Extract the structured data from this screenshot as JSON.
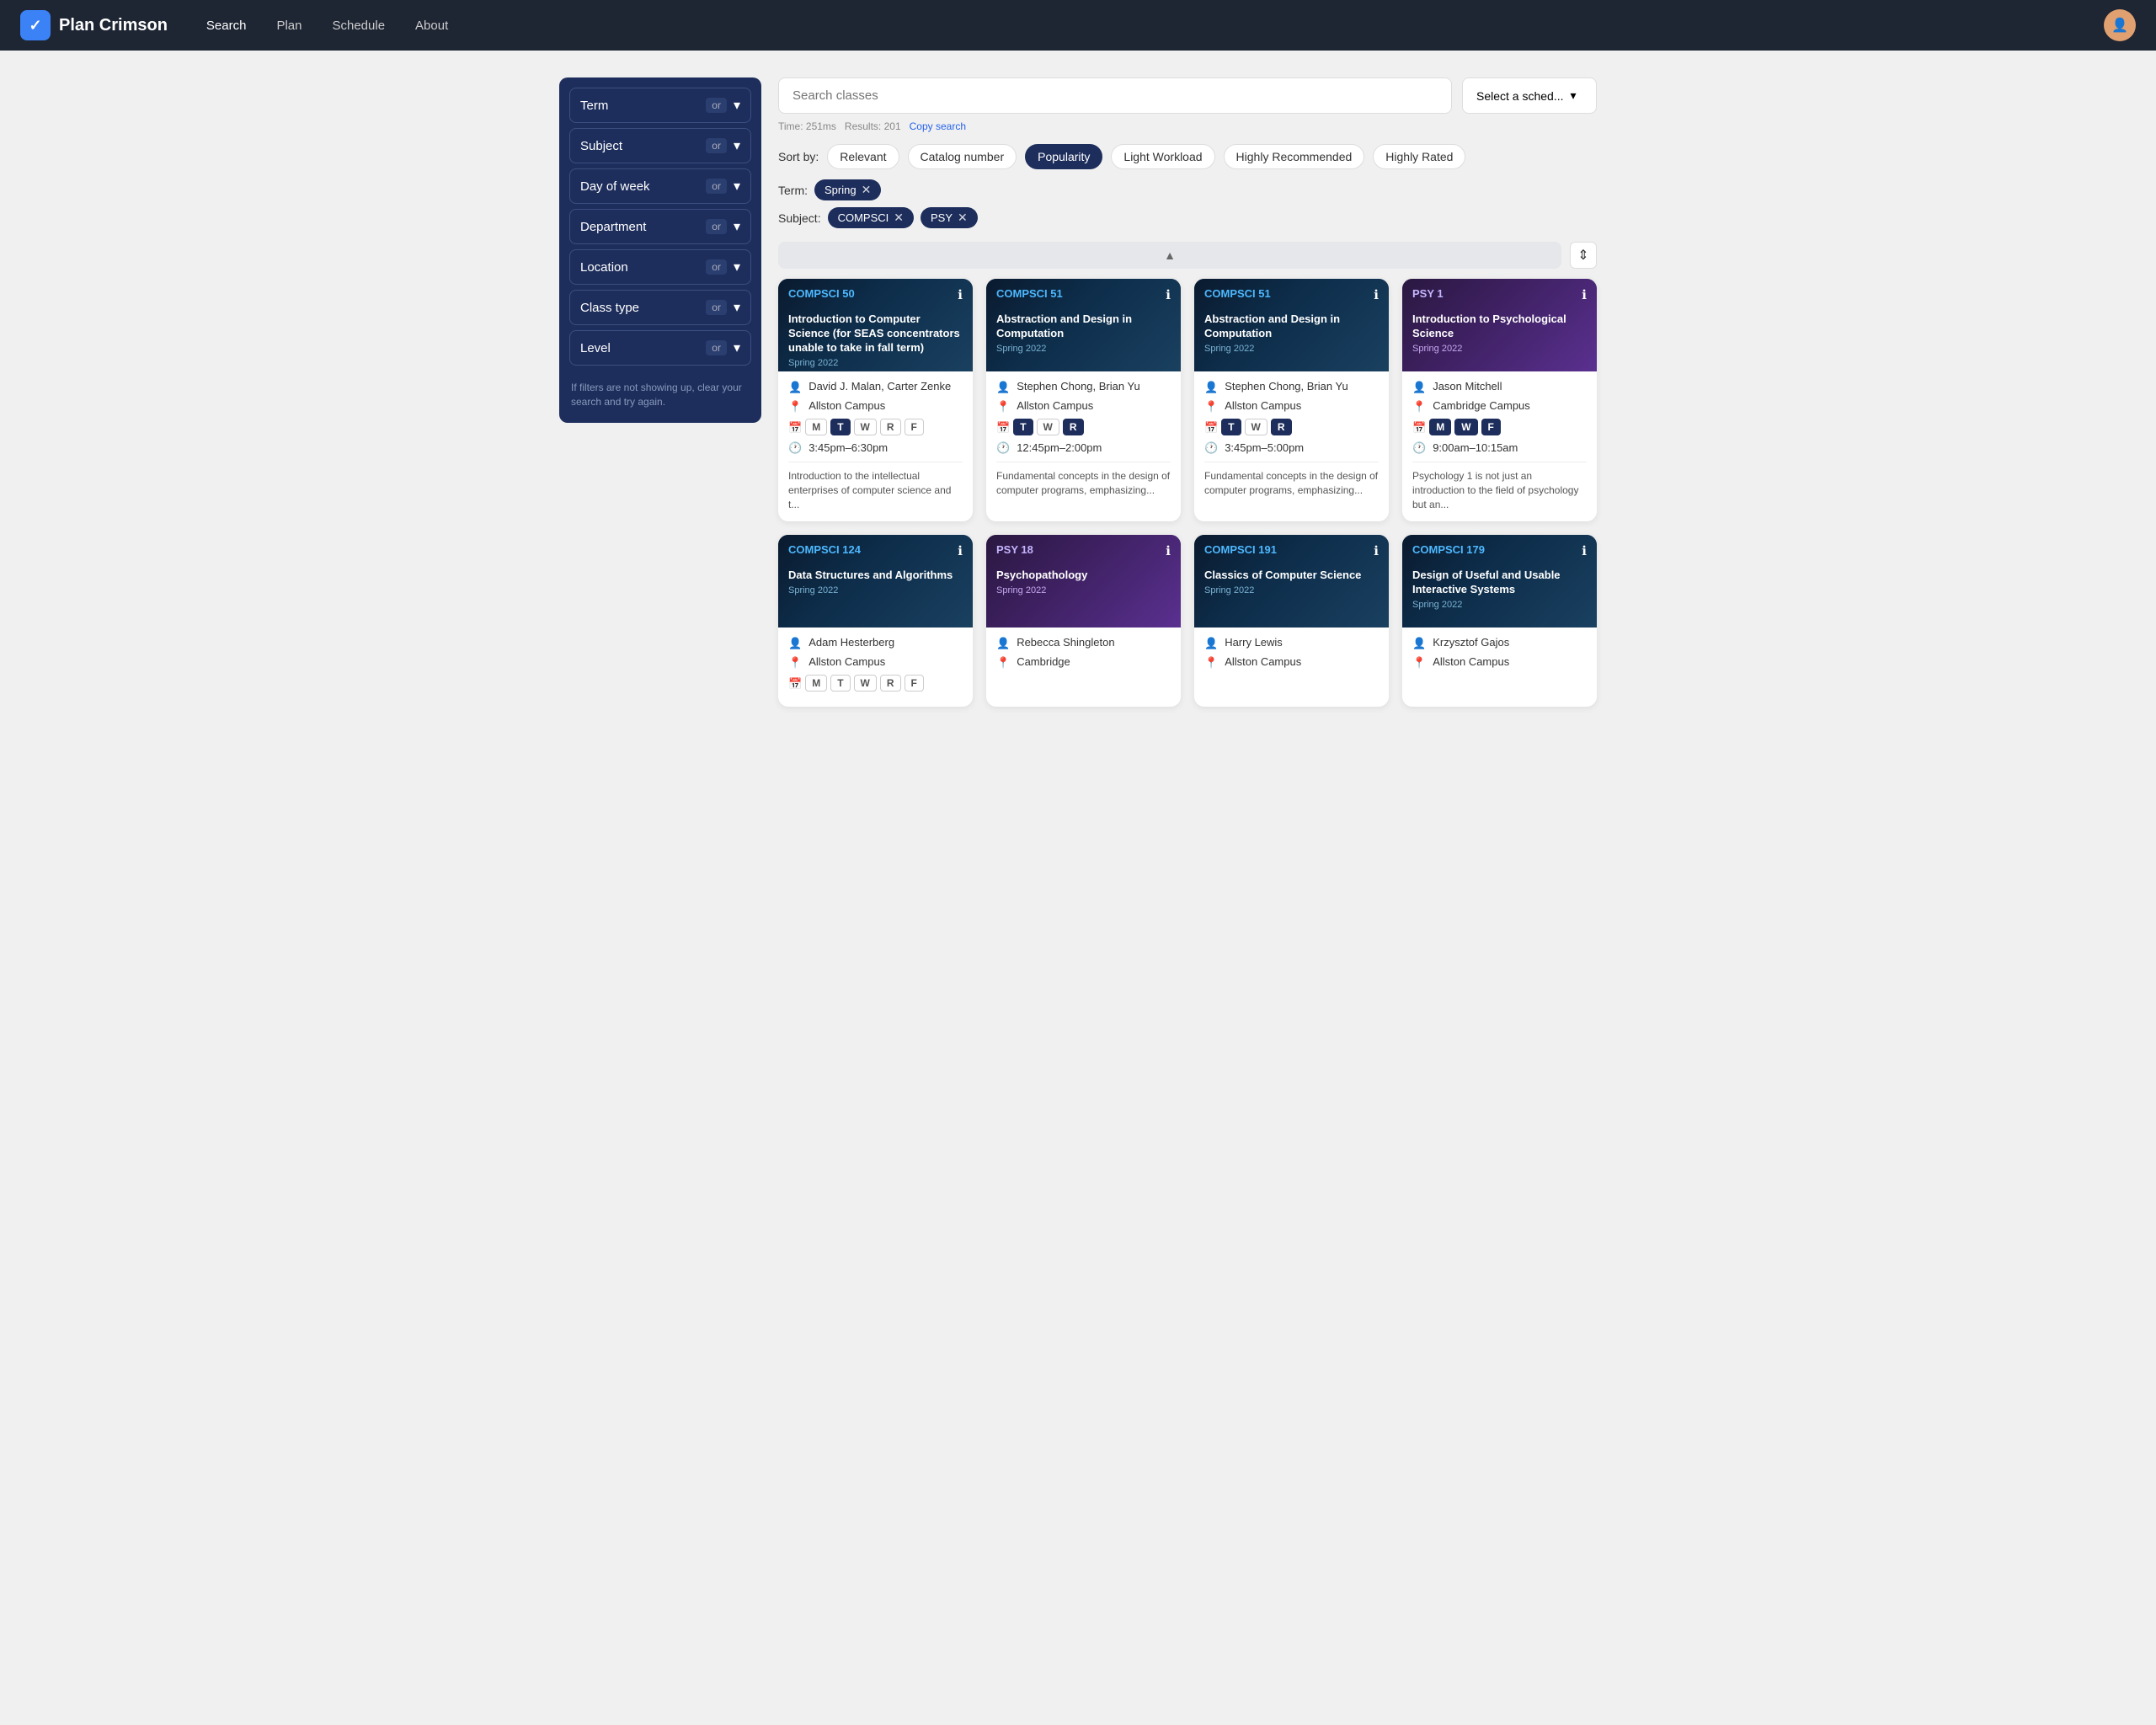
{
  "nav": {
    "logo_text": "Plan Crimson",
    "links": [
      "Search",
      "Plan",
      "Schedule",
      "About"
    ],
    "active_link": "Search"
  },
  "sidebar": {
    "filters": [
      {
        "label": "Term",
        "badge": "or"
      },
      {
        "label": "Subject",
        "badge": "or"
      },
      {
        "label": "Day of week",
        "badge": "or"
      },
      {
        "label": "Department",
        "badge": "or"
      },
      {
        "label": "Location",
        "badge": "or"
      },
      {
        "label": "Class type",
        "badge": "or"
      },
      {
        "label": "Level",
        "badge": "or"
      }
    ],
    "note": "If filters are not showing up, clear your search and try again."
  },
  "search": {
    "placeholder": "Search classes",
    "meta_time": "Time: 251ms",
    "meta_results": "Results: 201",
    "copy_link": "Copy search",
    "schedule_select": "Select a sched..."
  },
  "sort": {
    "label": "Sort by:",
    "options": [
      "Relevant",
      "Catalog number",
      "Popularity",
      "Light Workload",
      "Highly Recommended",
      "Highly Rated"
    ],
    "active": "Popularity"
  },
  "active_filters": {
    "term_label": "Term:",
    "term_tags": [
      {
        "text": "Spring",
        "removable": true
      }
    ],
    "subject_label": "Subject:",
    "subject_tags": [
      {
        "text": "COMPSCI",
        "removable": true
      },
      {
        "text": "PSY",
        "removable": true
      }
    ]
  },
  "courses": [
    {
      "code": "COMPSCI 50",
      "code_type": "compsci",
      "info": "ℹ",
      "title": "Introduction to Computer Science (for SEAS concentrators unable to take in fall term)",
      "term": "Spring 2022",
      "instructor": "David J. Malan, Carter Zenke",
      "location": "Allston Campus",
      "days": [
        "M",
        "T",
        "W",
        "R",
        "F"
      ],
      "active_days": [
        "T"
      ],
      "time": "3:45pm–6:30pm",
      "description": "Introduction to the intellectual enterprises of computer science and t..."
    },
    {
      "code": "COMPSCI 51",
      "code_type": "compsci",
      "info": "ℹ",
      "title": "Abstraction and Design in Computation",
      "term": "Spring 2022",
      "instructor": "Stephen Chong, Brian Yu",
      "location": "Allston Campus",
      "days": [
        "T",
        "W",
        "R"
      ],
      "active_days": [
        "T",
        "R"
      ],
      "time": "12:45pm–2:00pm",
      "description": "Fundamental concepts in the design of computer programs, emphasizing..."
    },
    {
      "code": "COMPSCI 51",
      "code_type": "compsci",
      "info": "ℹ",
      "title": "Abstraction and Design in Computation",
      "term": "Spring 2022",
      "instructor": "Stephen Chong, Brian Yu",
      "location": "Allston Campus",
      "days": [
        "T",
        "W",
        "R"
      ],
      "active_days": [
        "T",
        "R"
      ],
      "time": "3:45pm–5:00pm",
      "description": "Fundamental concepts in the design of computer programs, emphasizing..."
    },
    {
      "code": "PSY 1",
      "code_type": "psy",
      "info": "ℹ",
      "title": "Introduction to Psychological Science",
      "term": "Spring 2022",
      "instructor": "Jason Mitchell",
      "location": "Cambridge Campus",
      "days": [
        "M",
        "W",
        "F"
      ],
      "active_days": [
        "M",
        "W",
        "F"
      ],
      "time": "9:00am–10:15am",
      "description": "Psychology 1 is not just an introduction to the field of psychology but an..."
    },
    {
      "code": "COMPSCI 124",
      "code_type": "compsci",
      "info": "ℹ",
      "title": "Data Structures and Algorithms",
      "term": "Spring 2022",
      "instructor": "Adam Hesterberg",
      "location": "Allston Campus",
      "days": [
        "M",
        "T",
        "W",
        "R",
        "F"
      ],
      "active_days": [],
      "time": "",
      "description": ""
    },
    {
      "code": "PSY 18",
      "code_type": "psy",
      "info": "ℹ",
      "title": "Psychopathology",
      "term": "Spring 2022",
      "instructor": "Rebecca Shingleton",
      "location": "Cambridge",
      "days": [],
      "active_days": [],
      "time": "",
      "description": ""
    },
    {
      "code": "COMPSCI 191",
      "code_type": "compsci",
      "info": "ℹ",
      "title": "Classics of Computer Science",
      "term": "Spring 2022",
      "instructor": "Harry Lewis",
      "location": "Allston Campus",
      "days": [],
      "active_days": [],
      "time": "",
      "description": ""
    },
    {
      "code": "COMPSCI 179",
      "code_type": "compsci",
      "info": "ℹ",
      "title": "Design of Useful and Usable Interactive Systems",
      "term": "Spring 2022",
      "instructor": "Krzysztof Gajos",
      "location": "Allston Campus",
      "days": [],
      "active_days": [],
      "time": "",
      "description": ""
    }
  ]
}
